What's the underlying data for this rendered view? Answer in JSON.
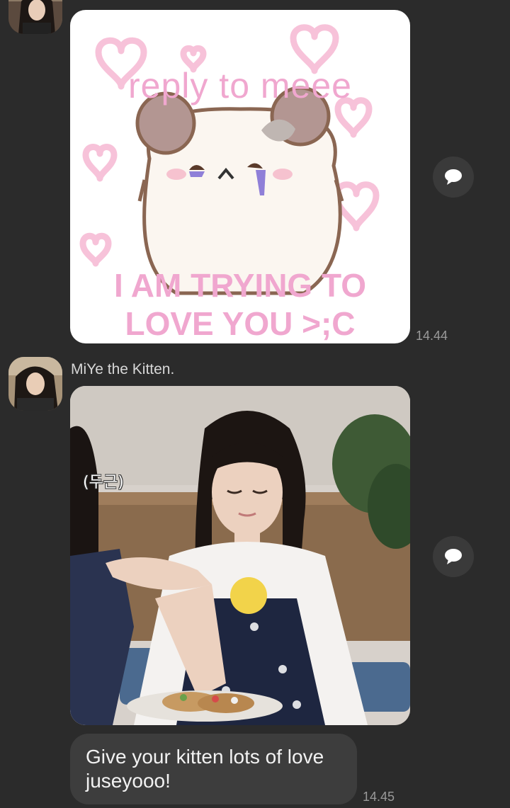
{
  "messages": [
    {
      "type": "sticker",
      "sticker_text_top": "reply to meee",
      "sticker_text_bottom": "I AM TRYING TO\nLOVE YOU >;C",
      "time": "14.44"
    },
    {
      "sender": "MiYe the Kitten.",
      "type": "photo",
      "photo_caption": "(두근)"
    },
    {
      "type": "text",
      "text": "Give your kitten lots of love juseyooo!",
      "time": "14.45"
    }
  ],
  "colors": {
    "background": "#2b2b2b",
    "bubble": "#3d3d3d",
    "sticker_pink": "#f0a7cf",
    "timestamp": "#9a9a9a"
  },
  "icons": {
    "reply_button": "speech-bubble-icon"
  }
}
